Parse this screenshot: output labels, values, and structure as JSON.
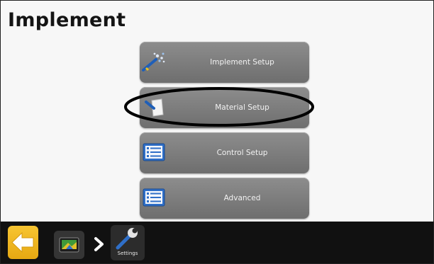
{
  "page": {
    "title": "Implement"
  },
  "menu": [
    {
      "label": "Implement Setup",
      "icon": "implement-spray-icon"
    },
    {
      "label": "Material Setup",
      "icon": "material-page-icon"
    },
    {
      "label": "Control Setup",
      "icon": "list-icon"
    },
    {
      "label": "Advanced",
      "icon": "list-icon"
    }
  ],
  "highlight": {
    "target": "Material Setup",
    "color": "#000000"
  },
  "breadcrumb": {
    "back_icon": "back-arrow-icon",
    "home_icon": "home-screen-icon",
    "separator_icon": "chevron-right-icon",
    "current_label": "Settings",
    "current_icon": "wrench-icon"
  },
  "colors": {
    "button": "#7e7e7e",
    "button_text": "#f2f2f2",
    "back_button": "#f2b622",
    "bottom_bar": "#111111",
    "icon_blue": "#2f6fc8"
  }
}
